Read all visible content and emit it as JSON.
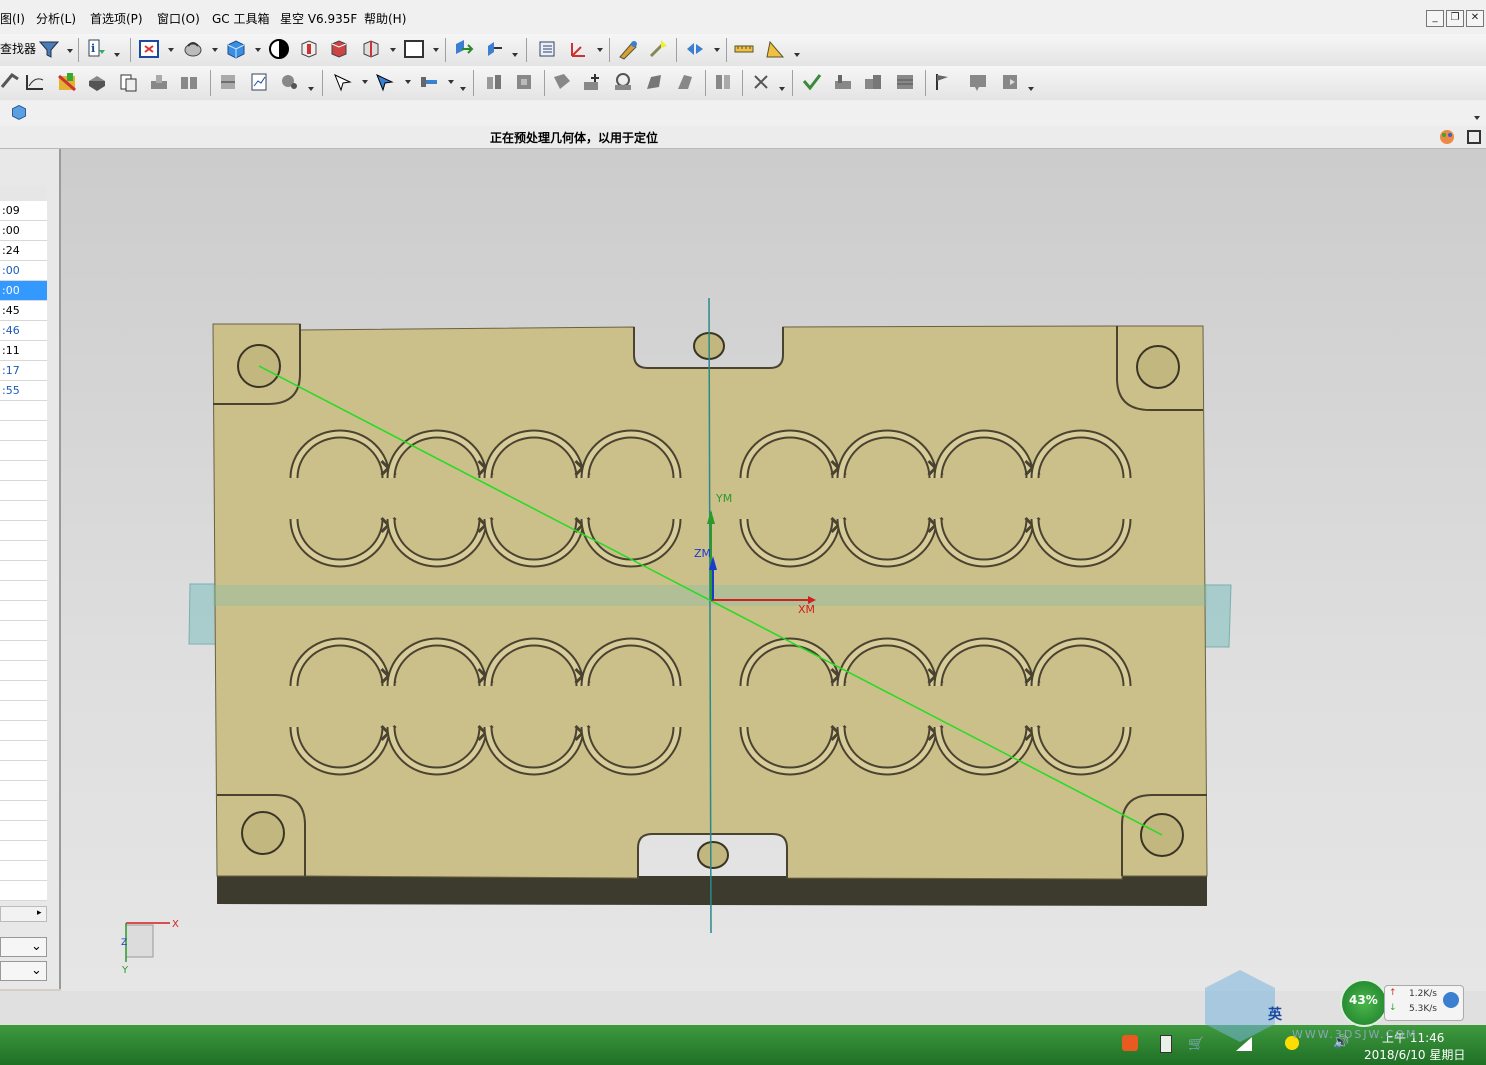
{
  "menubar": {
    "items": [
      "图(I)",
      "分析(L)",
      "首选项(P)",
      "窗口(O)",
      "GC 工具箱",
      "星空 V6.935F",
      "帮助(H)"
    ]
  },
  "toolbar": {
    "finder_label": "查找器"
  },
  "status": {
    "message": "正在预处理几何体，以用于定位"
  },
  "left_panel": {
    "rows": [
      ":09",
      ":00",
      ":24",
      ":00",
      ":00",
      ":45",
      ":46",
      ":11",
      ":17",
      ":55"
    ],
    "highlight_row": 4,
    "blue_rows": [
      3,
      6,
      8,
      9
    ]
  },
  "viewport": {
    "axis_labels": {
      "ym": "YM",
      "zm": "ZM",
      "xm": "XM"
    },
    "triad_labels": {
      "x": "X",
      "y": "Y",
      "z": "Z"
    },
    "colors": {
      "part_top": "#cbbf8a",
      "part_side": "#3d3a2e",
      "datum_plane": "#7fbfbf",
      "line": "#22dd22",
      "axis": "#2a8a8a"
    }
  },
  "tray": {
    "ime": "英",
    "percent": "43%",
    "up_speed": "1.2K/s",
    "down_speed": "5.3K/s",
    "time": "上午 11:46",
    "date": "2018/6/10 星期日",
    "watermark": "WWW.3DSJW.COM"
  }
}
